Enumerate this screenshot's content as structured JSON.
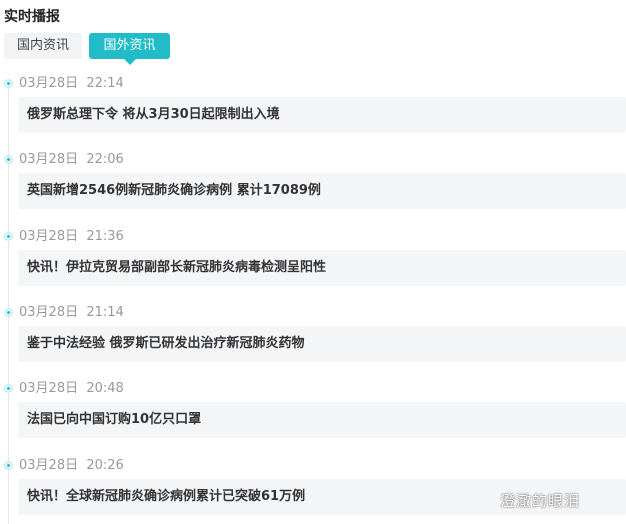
{
  "header": {
    "title": "实时播报"
  },
  "tabs": [
    {
      "label": "国内资讯",
      "active": false
    },
    {
      "label": "国外资讯",
      "active": true
    }
  ],
  "accent_color": "#22bcc8",
  "news": [
    {
      "time": "03月28日  22:14",
      "headline": "俄罗斯总理下令 将从3月30日起限制出入境"
    },
    {
      "time": "03月28日  22:06",
      "headline": "英国新增2546例新冠肺炎确诊病例 累计17089例"
    },
    {
      "time": "03月28日  21:36",
      "headline": "快讯！伊拉克贸易部副部长新冠肺炎病毒检测呈阳性"
    },
    {
      "time": "03月28日  21:14",
      "headline": "鉴于中法经验 俄罗斯已研发出治疗新冠肺炎药物"
    },
    {
      "time": "03月28日  20:48",
      "headline": "法国已向中国订购10亿只口罩"
    },
    {
      "time": "03月28日  20:26",
      "headline": "快讯！全球新冠肺炎确诊病例累计已突破61万例"
    }
  ],
  "watermark": "澄澈的眼泪"
}
